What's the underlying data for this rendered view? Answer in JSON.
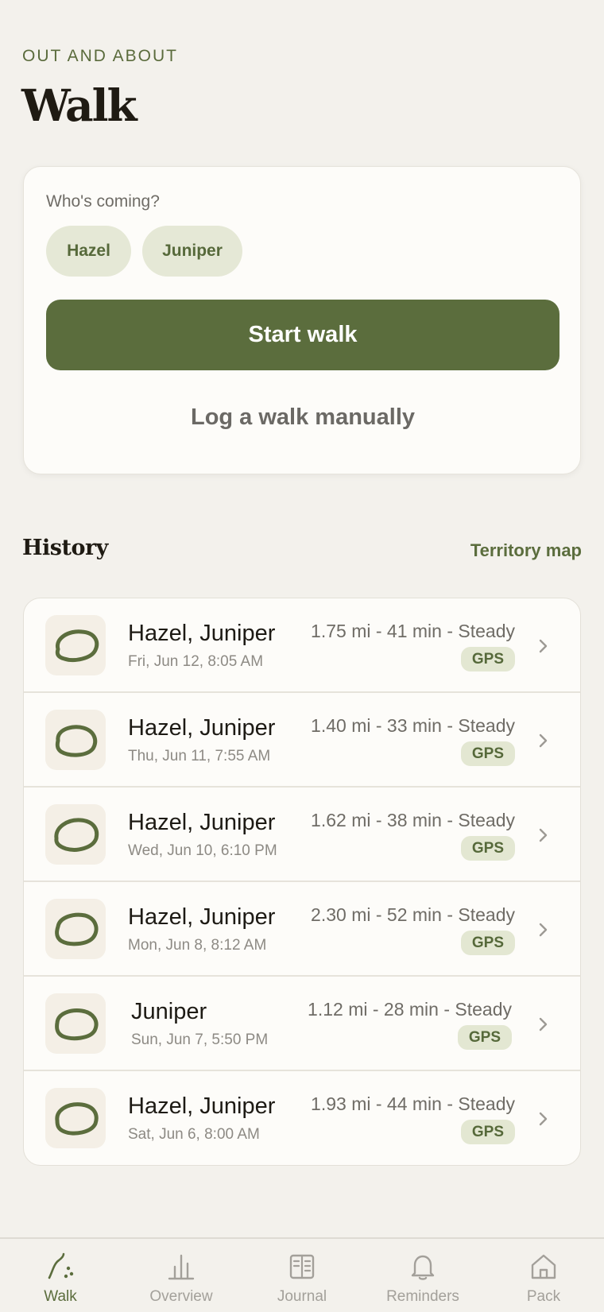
{
  "header": {
    "eyebrow": "OUT AND ABOUT",
    "title": "Walk"
  },
  "start_card": {
    "who_label": "Who's coming?",
    "companions": [
      "Hazel",
      "Juniper"
    ],
    "start_label": "Start walk",
    "manual_label": "Log a walk manually"
  },
  "history": {
    "title": "History",
    "map_link": "Territory map",
    "walks": [
      {
        "names": "Hazel, Juniper",
        "datetime": "Fri, Jun 12, 8:05 AM",
        "stats": "1.75 mi - 41 min - Steady",
        "badge": "GPS"
      },
      {
        "names": "Hazel, Juniper",
        "datetime": "Thu, Jun 11, 7:55 AM",
        "stats": "1.40 mi - 33 min - Steady",
        "badge": "GPS"
      },
      {
        "names": "Hazel, Juniper",
        "datetime": "Wed, Jun 10, 6:10 PM",
        "stats": "1.62 mi - 38 min - Steady",
        "badge": "GPS"
      },
      {
        "names": "Hazel, Juniper",
        "datetime": "Mon, Jun 8, 8:12 AM",
        "stats": "2.30 mi - 52 min - Steady",
        "badge": "GPS"
      },
      {
        "names": "Juniper",
        "datetime": "Sun, Jun 7, 5:50 PM",
        "stats": "1.12 mi - 28 min - Steady",
        "badge": "GPS"
      },
      {
        "names": "Hazel, Juniper",
        "datetime": "Sat, Jun 6, 8:00 AM",
        "stats": "1.93 mi - 44 min - Steady",
        "badge": "GPS"
      }
    ]
  },
  "tabbar": {
    "tabs": [
      {
        "label": "Walk",
        "icon": "walk-path-icon",
        "active": true
      },
      {
        "label": "Overview",
        "icon": "bar-chart-icon",
        "active": false
      },
      {
        "label": "Journal",
        "icon": "book-icon",
        "active": false
      },
      {
        "label": "Reminders",
        "icon": "bell-icon",
        "active": false
      },
      {
        "label": "Pack",
        "icon": "house-icon",
        "active": false
      }
    ]
  },
  "colors": {
    "accent": "#5b6d3d",
    "background": "#f3f1ec",
    "card": "#fdfcf9",
    "chip": "#e5e8d6"
  }
}
